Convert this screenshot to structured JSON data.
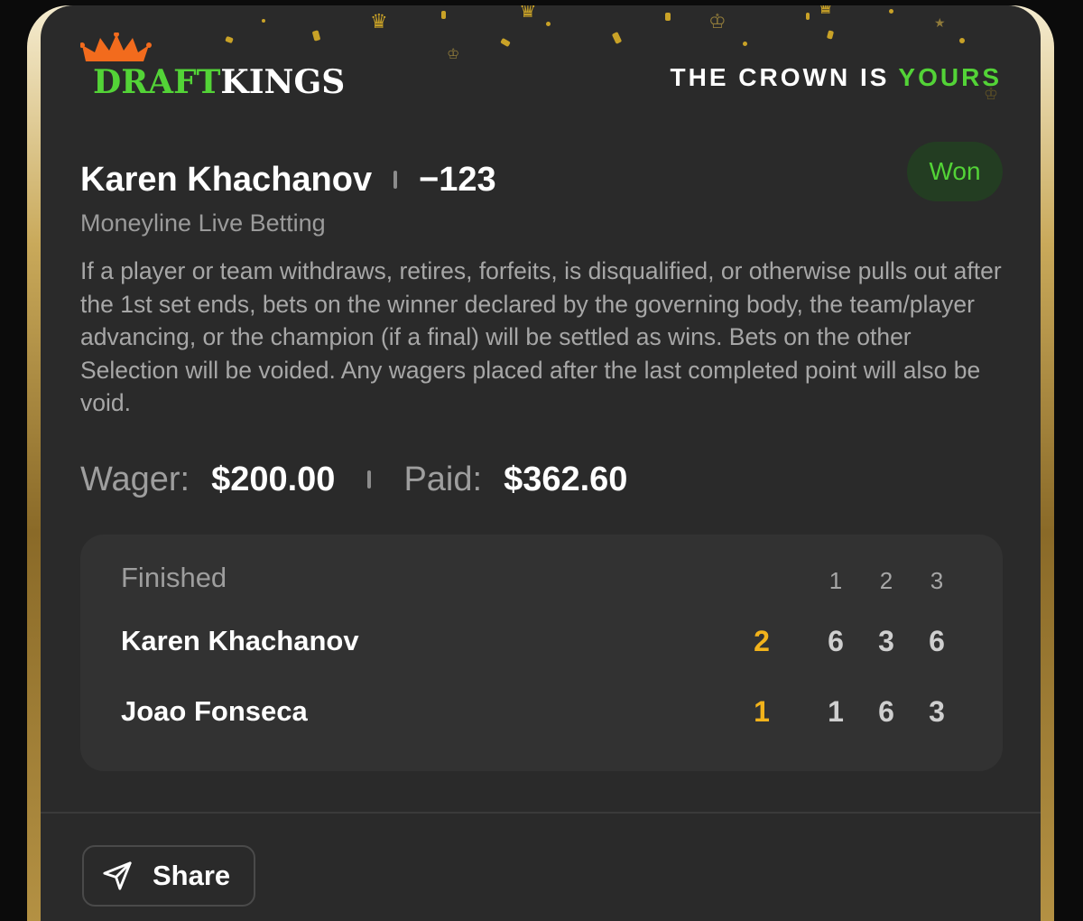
{
  "brand": {
    "name_part1": "DRAFT",
    "name_part2": "KINGS",
    "tagline_part1": "THE CROWN IS",
    "tagline_part2": "YOURS",
    "accent_color": "#53d337",
    "logo_crown_color": "#f26b1d"
  },
  "bet": {
    "selection": "Karen Khachanov",
    "odds": "−123",
    "status": "Won",
    "market": "Moneyline Live Betting",
    "rules": "If a player or team withdraws, retires, forfeits, is disqualified, or otherwise pulls out after the 1st set ends, bets on the winner declared by the governing body, the team/player advancing, or the champion (if a final) will be settled as wins. Bets on the other Selection will be voided. Any wagers placed after the last completed point will also be void.",
    "wager_label": "Wager:",
    "wager_value": "$200.00",
    "paid_label": "Paid:",
    "paid_value": "$362.60"
  },
  "scoreboard": {
    "status": "Finished",
    "set_headers": [
      "1",
      "2",
      "3"
    ],
    "players": [
      {
        "name": "Karen Khachanov",
        "sets_won": "2",
        "sets": [
          "6",
          "3",
          "6"
        ]
      },
      {
        "name": "Joao Fonseca",
        "sets_won": "1",
        "sets": [
          "1",
          "6",
          "3"
        ]
      }
    ],
    "total_color": "#f2b31b"
  },
  "actions": {
    "share_label": "Share",
    "share_icon": "send-icon"
  }
}
